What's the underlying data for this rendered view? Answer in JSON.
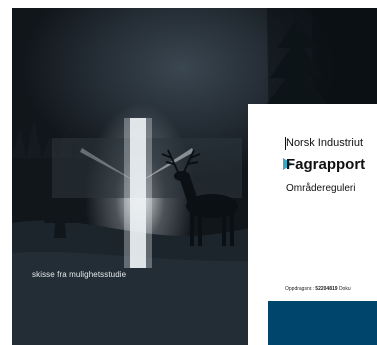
{
  "image": {
    "caption": "skisse fra mulighetsstudie",
    "scene": "night-forest-with-deer-icon"
  },
  "document": {
    "organization": "Norsk Industriut",
    "title": "Fagrapport",
    "subtitle": "Områdereguleri",
    "meta": {
      "label": "Oppdragsnr.:",
      "number": "52204819",
      "next": "Doku"
    }
  },
  "colors": {
    "band": "#00466c",
    "arrow": "#3aa7c4"
  }
}
